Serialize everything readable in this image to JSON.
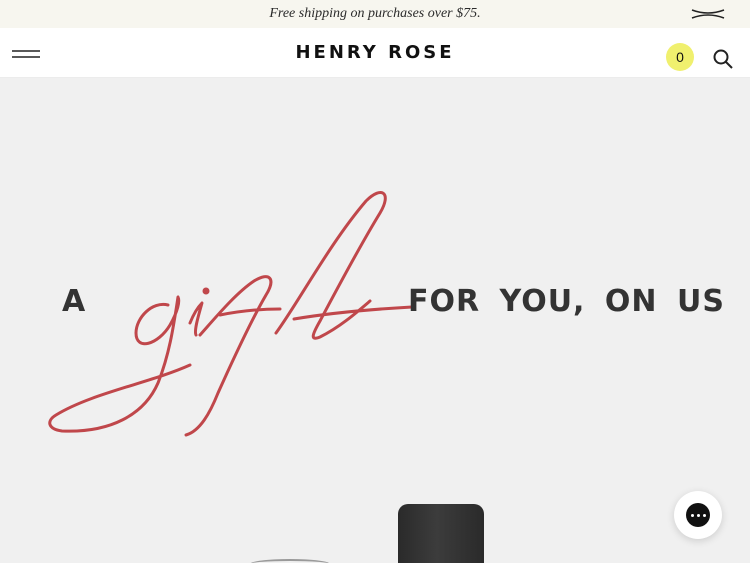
{
  "announcement": {
    "text": "Free shipping on purchases over $75.",
    "close_icon": "close-icon"
  },
  "header": {
    "menu_icon": "hamburger-menu-icon",
    "logo": "HENRY ROSE",
    "cart_count": "0",
    "search_icon": "search-icon"
  },
  "hero": {
    "word_a": "A",
    "script_word": "gift",
    "word_rest": "FOR YOU, ON US",
    "script_color": "#c0474b"
  },
  "chat": {
    "icon": "chat-icon"
  }
}
